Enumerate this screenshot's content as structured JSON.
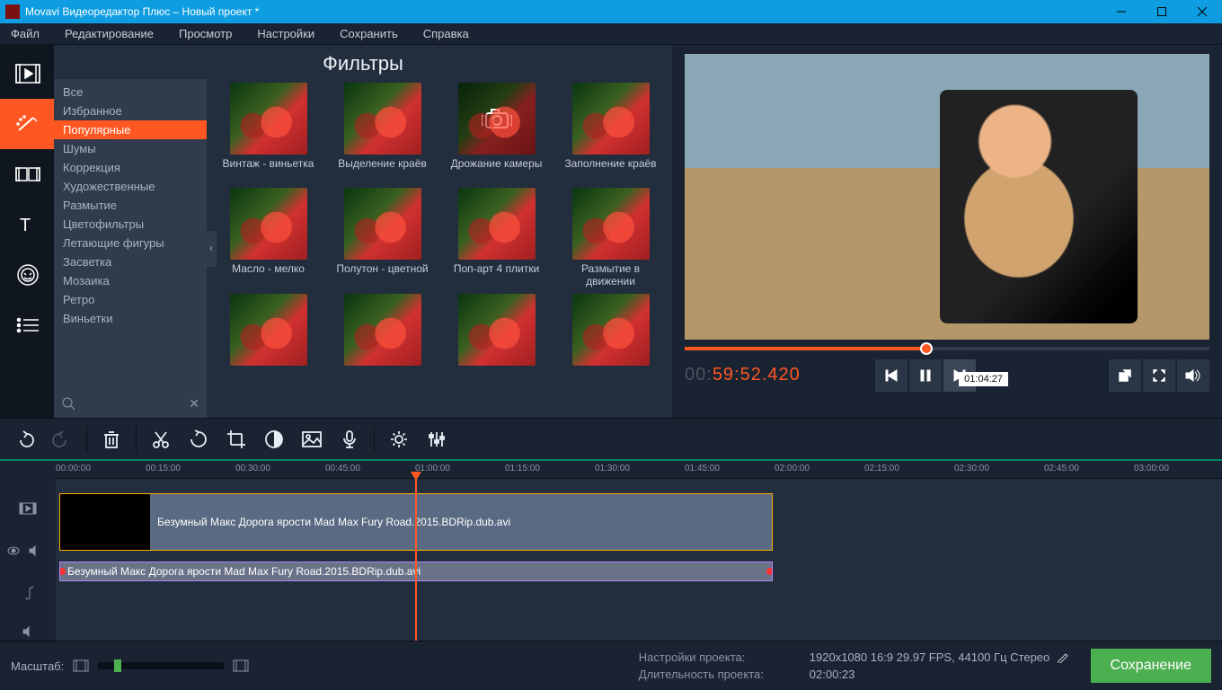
{
  "window": {
    "title": "Movavi Видеоредактор Плюс – Новый проект *"
  },
  "menu": [
    "Файл",
    "Редактирование",
    "Просмотр",
    "Настройки",
    "Сохранить",
    "Справка"
  ],
  "filters": {
    "title": "Фильтры",
    "categories": [
      "Все",
      "Избранное",
      "Популярные",
      "Шумы",
      "Коррекция",
      "Художественные",
      "Размытие",
      "Цветофильтры",
      "Летающие фигуры",
      "Засветка",
      "Мозаика",
      "Ретро",
      "Виньетки"
    ],
    "active_category": 2,
    "items": [
      {
        "label": "Винтаж - виньетка"
      },
      {
        "label": "Выделение краёв"
      },
      {
        "label": "Дрожание камеры",
        "cam": true
      },
      {
        "label": "Заполнение краёв"
      },
      {
        "label": "Масло - мелко"
      },
      {
        "label": "Полутон - цветной"
      },
      {
        "label": "Поп-арт 4 плитки"
      },
      {
        "label": "Размытие в движении"
      },
      {
        "label": ""
      },
      {
        "label": ""
      },
      {
        "label": ""
      },
      {
        "label": ""
      }
    ]
  },
  "preview": {
    "timecode_prefix": "00:",
    "timecode": "59:52.420",
    "tooltip": "01:04:27"
  },
  "ruler": [
    "00:00:00",
    "00:15:00",
    "00:30:00",
    "00:45:00",
    "01:00:00",
    "01:15:00",
    "01:30:00",
    "01:45:00",
    "02:00:00",
    "02:15:00",
    "02:30:00",
    "02:45:00",
    "03:00:00"
  ],
  "clips": {
    "video": "Безумный Макс Дорога ярости  Mad Max Fury Road.2015.BDRip.dub.avi",
    "audio": "Безумный Макс Дорога ярости  Mad Max Fury Road.2015.BDRip.dub.avi"
  },
  "status": {
    "zoom_label": "Масштаб:",
    "project_settings_label": "Настройки проекта:",
    "project_settings_value": "1920x1080 16:9 29.97 FPS, 44100 Гц Стерео",
    "duration_label": "Длительность проекта:",
    "duration_value": "02:00:23",
    "save": "Сохранение"
  }
}
